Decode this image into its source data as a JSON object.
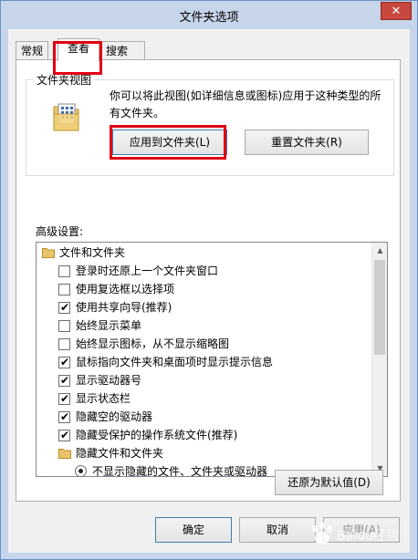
{
  "window": {
    "title": "文件夹选项",
    "close_glyph": "✕"
  },
  "tabs": [
    {
      "label": "常规"
    },
    {
      "label": "查看"
    },
    {
      "label": "搜索"
    }
  ],
  "folder_views": {
    "group_title": "文件夹视图",
    "description": "你可以将此视图(如详细信息或图标)应用于这种类型的所有文件夹。",
    "apply_button": "应用到文件夹(L)",
    "reset_button": "重置文件夹(R)"
  },
  "advanced": {
    "label": "高级设置:",
    "items": [
      {
        "type": "folder",
        "label": "文件和文件夹"
      },
      {
        "type": "checkbox",
        "checked": false,
        "label": "登录时还原上一个文件夹窗口"
      },
      {
        "type": "checkbox",
        "checked": false,
        "label": "使用复选框以选择项"
      },
      {
        "type": "checkbox",
        "checked": true,
        "label": "使用共享向导(推荐)"
      },
      {
        "type": "checkbox",
        "checked": false,
        "label": "始终显示菜单"
      },
      {
        "type": "checkbox",
        "checked": false,
        "label": "始终显示图标，从不显示缩略图"
      },
      {
        "type": "checkbox",
        "checked": true,
        "label": "鼠标指向文件夹和桌面项时显示提示信息"
      },
      {
        "type": "checkbox",
        "checked": true,
        "label": "显示驱动器号"
      },
      {
        "type": "checkbox",
        "checked": true,
        "label": "显示状态栏"
      },
      {
        "type": "checkbox",
        "checked": true,
        "label": "隐藏空的驱动器"
      },
      {
        "type": "checkbox",
        "checked": true,
        "label": "隐藏受保护的操作系统文件(推荐)"
      },
      {
        "type": "folder",
        "label": "隐藏文件和文件夹"
      },
      {
        "type": "radio",
        "checked": true,
        "label": "不显示隐藏的文件、文件夹或驱动器"
      }
    ],
    "check_glyph": "✔",
    "scroll_up_glyph": "▲",
    "scroll_down_glyph": "▼"
  },
  "restore_defaults_button": "还原为默认值(D)",
  "footer": {
    "ok": "确定",
    "cancel": "取消",
    "apply": "应用(A)"
  },
  "watermark": "Baidu经验",
  "colors": {
    "highlight_red": "#e00014",
    "window_border": "#6c8fc4",
    "close_button": "#c7463e"
  }
}
